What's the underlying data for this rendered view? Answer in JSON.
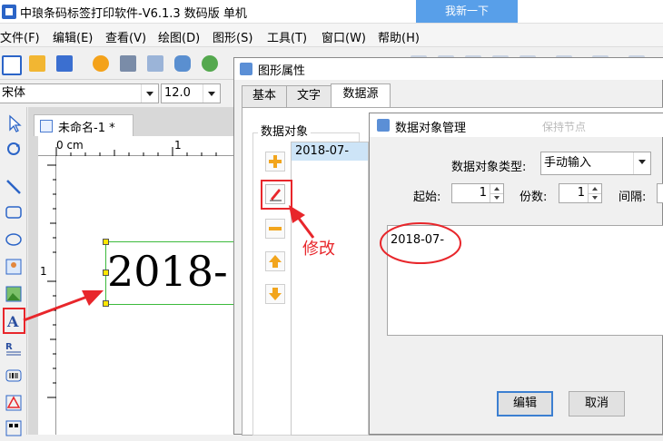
{
  "app": {
    "title": "中琅条码标签打印软件-V6.1.3 数码版 单机",
    "blur_button": "我新一下"
  },
  "menu": [
    "文件(F)",
    "编辑(E)",
    "查看(V)",
    "绘图(D)",
    "图形(S)",
    "工具(T)",
    "窗口(W)",
    "帮助(H)"
  ],
  "fontbar": {
    "font_name": "宋体",
    "font_size": "12.0"
  },
  "document": {
    "tab_title": "未命名-1 *",
    "ruler_unit": "0 cm",
    "ruler_mark_h": "1",
    "ruler_mark_v": "1",
    "canvas_text": "2018-"
  },
  "shape_dialog": {
    "title": "图形属性",
    "tabs": [
      "基本",
      "文字",
      "数据源"
    ],
    "active_tab": "数据源",
    "group_label": "数据对象",
    "list_items": [
      "2018-07-"
    ]
  },
  "manager_dialog": {
    "title": "数据对象管理",
    "blur_caption": "保持节点",
    "type_label": "数据对象类型:",
    "type_value": "手动输入",
    "start_label": "起始:",
    "start_value": "1",
    "copies_label": "份数:",
    "copies_value": "1",
    "interval_label": "间隔:",
    "content": "2018-07-",
    "edit_button": "编辑",
    "cancel_button": "取消"
  },
  "annotation": {
    "text": "修改",
    "color": "#e8262b"
  }
}
